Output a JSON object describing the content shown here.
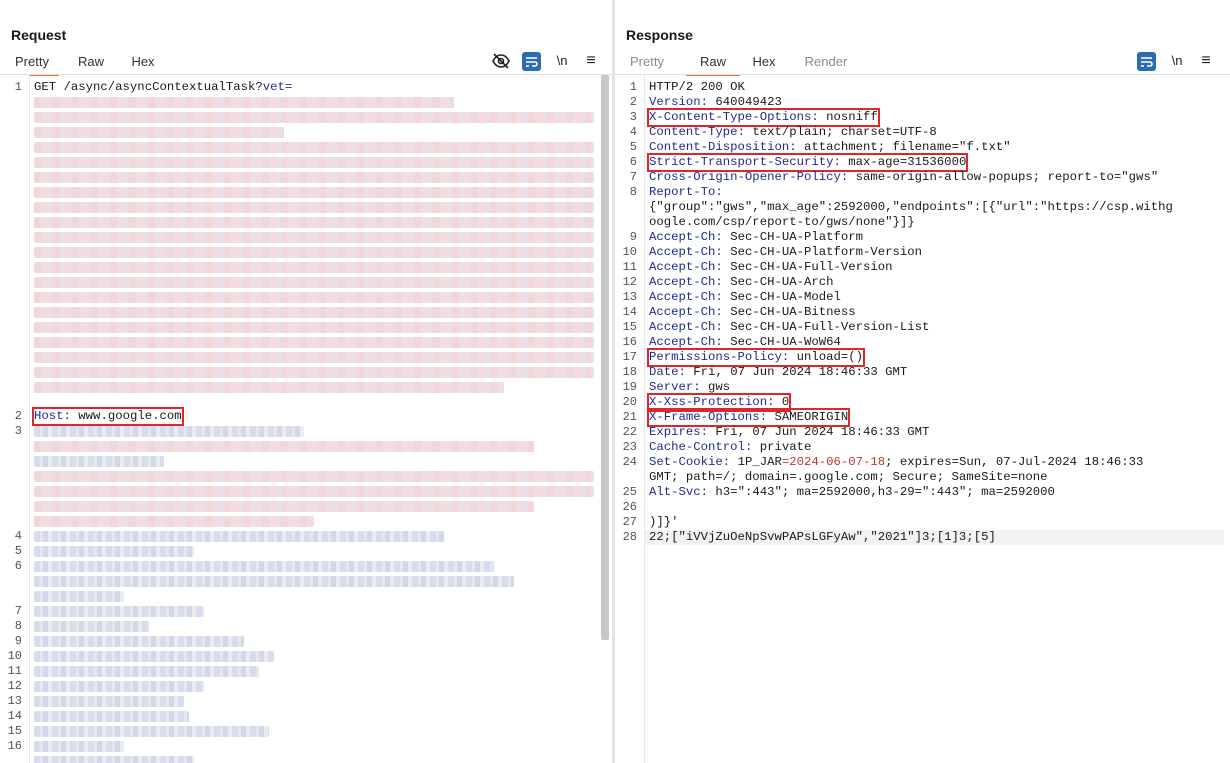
{
  "request": {
    "title": "Request",
    "tabs": [
      {
        "label": "Pretty",
        "active": true
      },
      {
        "label": "Raw",
        "active": false
      },
      {
        "label": "Hex",
        "active": false
      }
    ],
    "toolbar": {
      "newline_label": "\\n",
      "menu_label": "≡"
    },
    "lines": [
      {
        "n": "1",
        "text": "GET /async/asyncContextualTask?",
        "param": "vet="
      },
      {
        "n": "2",
        "key": "Host",
        "value": " www.google.com"
      },
      {
        "n": "3"
      },
      {
        "n": "4"
      },
      {
        "n": "5"
      },
      {
        "n": "6"
      },
      {
        "n": "7"
      },
      {
        "n": "8"
      },
      {
        "n": "9"
      },
      {
        "n": "10"
      },
      {
        "n": "11"
      },
      {
        "n": "12"
      },
      {
        "n": "13"
      },
      {
        "n": "14"
      },
      {
        "n": "15"
      },
      {
        "n": "16"
      }
    ]
  },
  "response": {
    "title": "Response",
    "tabs": [
      {
        "label": "Pretty",
        "active": false
      },
      {
        "label": "Raw",
        "active": true
      },
      {
        "label": "Hex",
        "active": false
      },
      {
        "label": "Render",
        "active": false
      }
    ],
    "toolbar": {
      "newline_label": "\\n",
      "menu_label": "≡"
    },
    "lines": [
      {
        "n": "1",
        "plain": "HTTP/2 200 OK"
      },
      {
        "n": "2",
        "key": "Version",
        "value": " 640049423"
      },
      {
        "n": "3",
        "key": "X-Content-Type-Options",
        "value": " nosniff",
        "highlight": true
      },
      {
        "n": "4",
        "key": "Content-Type",
        "value": " text/plain; charset=UTF-8"
      },
      {
        "n": "5",
        "key": "Content-Disposition",
        "value": " attachment; filename=\"f.txt\""
      },
      {
        "n": "6",
        "key": "Strict-Transport-Security",
        "value": " max-age=31536000",
        "highlight": true
      },
      {
        "n": "7",
        "key": "Cross-Origin-Opener-Policy",
        "value": " same-origin-allow-popups; report-to=\"gws\""
      },
      {
        "n": "8",
        "key": "Report-To",
        "value": ""
      },
      {
        "n": "",
        "plain": "{\"group\":\"gws\",\"max_age\":2592000,\"endpoints\":[{\"url\":\"https://csp.withg"
      },
      {
        "n": "",
        "plain": "oogle.com/csp/report-to/gws/none\"}]}"
      },
      {
        "n": "9",
        "key": "Accept-Ch",
        "value": " Sec-CH-UA-Platform"
      },
      {
        "n": "10",
        "key": "Accept-Ch",
        "value": " Sec-CH-UA-Platform-Version"
      },
      {
        "n": "11",
        "key": "Accept-Ch",
        "value": " Sec-CH-UA-Full-Version"
      },
      {
        "n": "12",
        "key": "Accept-Ch",
        "value": " Sec-CH-UA-Arch"
      },
      {
        "n": "13",
        "key": "Accept-Ch",
        "value": " Sec-CH-UA-Model"
      },
      {
        "n": "14",
        "key": "Accept-Ch",
        "value": " Sec-CH-UA-Bitness"
      },
      {
        "n": "15",
        "key": "Accept-Ch",
        "value": " Sec-CH-UA-Full-Version-List"
      },
      {
        "n": "16",
        "key": "Accept-Ch",
        "value": " Sec-CH-UA-WoW64"
      },
      {
        "n": "17",
        "key": "Permissions-Policy",
        "value": " unload=()",
        "highlight": true
      },
      {
        "n": "18",
        "key": "Date",
        "value": " Fri, 07 Jun 2024 18:46:33 GMT"
      },
      {
        "n": "19",
        "key": "Server",
        "value": " gws"
      },
      {
        "n": "20",
        "key": "X-Xss-Protection",
        "value": " 0",
        "highlight": true
      },
      {
        "n": "21",
        "key": "X-Frame-Options",
        "value": " SAMEORIGIN",
        "highlight": true
      },
      {
        "n": "22",
        "key": "Expires",
        "value": " Fri, 07 Jun 2024 18:46:33 GMT"
      },
      {
        "n": "23",
        "key": "Cache-Control",
        "value": " private"
      },
      {
        "n": "24",
        "key": "Set-Cookie",
        "value": " 1P_JAR",
        "value_red": "=2024-06-07-18",
        "value_after": "; expires=Sun, 07-Jul-2024 18:46:33"
      },
      {
        "n": "",
        "plain": "GMT; path=/; domain=.google.com; Secure; SameSite=none"
      },
      {
        "n": "25",
        "key": "Alt-Svc",
        "value": " h3=\":443\"; ma=2592000,h3-29=\":443\"; ma=2592000"
      },
      {
        "n": "26",
        "plain": ""
      },
      {
        "n": "27",
        "plain": ")]}'"
      },
      {
        "n": "28",
        "plain": "22;[\"iVVjZuOeNpSvwPAPsLGFyAw\",\"2021\"]3;[1]3;[5]"
      }
    ]
  }
}
